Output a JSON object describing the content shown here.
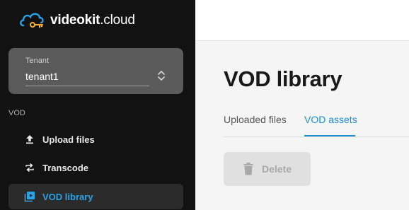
{
  "brand": {
    "name_bold": "videokit",
    "name_suffix": ".cloud"
  },
  "tenant": {
    "label": "Tenant",
    "value": "tenant1"
  },
  "sidebar": {
    "section_label": "VOD",
    "items": [
      {
        "label": "Upload files",
        "icon": "upload-icon"
      },
      {
        "label": "Transcode",
        "icon": "swap-icon"
      },
      {
        "label": "VOD library",
        "icon": "video-library-icon",
        "active": true
      }
    ]
  },
  "main": {
    "title": "VOD library",
    "tabs": [
      {
        "label": "Uploaded files"
      },
      {
        "label": "VOD assets",
        "active": true
      }
    ],
    "delete_label": "Delete"
  },
  "colors": {
    "accent": "#1a8fd1",
    "sidebar_bg": "#121212",
    "tenant_bg": "#5a5a5a"
  }
}
